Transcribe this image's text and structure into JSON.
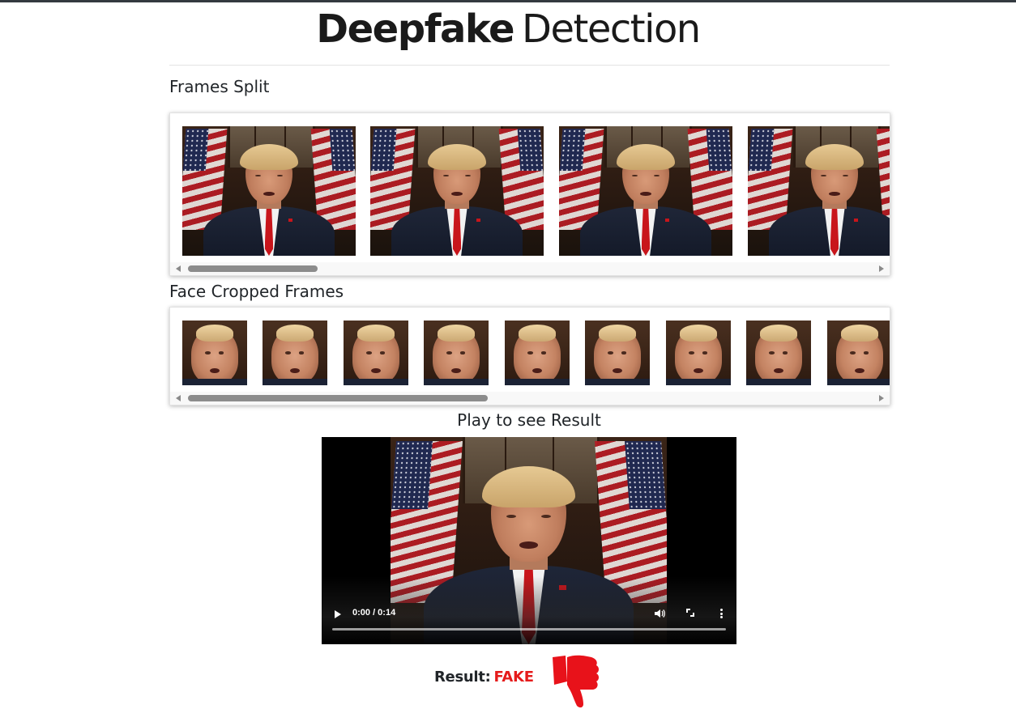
{
  "header": {
    "brand_bold": "Deepfake",
    "brand_light": "Detection"
  },
  "frames_split": {
    "title": "Frames Split",
    "count_visible": 4
  },
  "face_cropped": {
    "title": "Face Cropped Frames",
    "count_visible": 9
  },
  "player": {
    "title": "Play to see Result",
    "time": "0:00 / 0:14"
  },
  "result": {
    "label": "Result:",
    "value": "FAKE",
    "color": "#e51b1b"
  },
  "icons": {
    "verdict": "thumbs-down-icon",
    "play": "play-icon",
    "volume": "volume-icon",
    "fullscreen": "fullscreen-icon",
    "more": "more-vert-icon"
  }
}
